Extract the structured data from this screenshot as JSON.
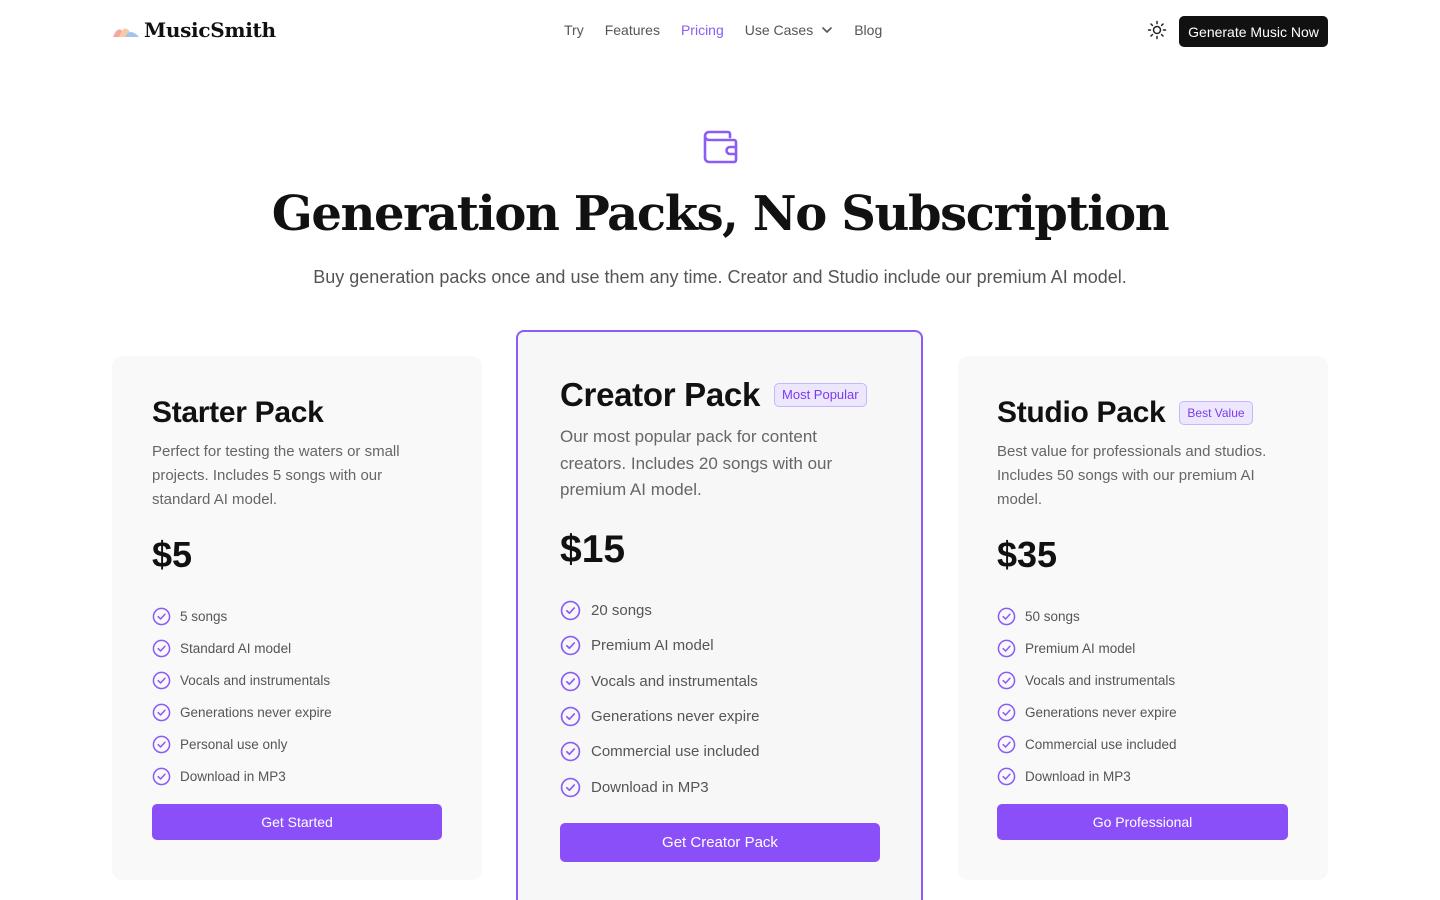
{
  "header": {
    "logo_text": "MusicSmith",
    "nav": [
      {
        "label": "Try",
        "active": false
      },
      {
        "label": "Features",
        "active": false
      },
      {
        "label": "Pricing",
        "active": true
      },
      {
        "label": "Use Cases",
        "active": false,
        "has_dropdown": true
      },
      {
        "label": "Blog",
        "active": false
      }
    ],
    "theme_icon": "sun-icon",
    "cta_label": "Generate Music Now"
  },
  "hero": {
    "icon": "wallet-icon",
    "title": "Generation Packs, No Subscription",
    "subtitle": "Buy generation packs once and use them any time. Creator and Studio include our premium AI model."
  },
  "plans": [
    {
      "name": "Starter Pack",
      "badge": "",
      "description": "Perfect for testing the waters or small projects. Includes 5 songs with our standard AI model.",
      "price": "$5",
      "features": [
        "5 songs",
        "Standard AI model",
        "Vocals and instrumentals",
        "Generations never expire",
        "Personal use only",
        "Download in MP3"
      ],
      "button_label": "Get Started"
    },
    {
      "name": "Creator Pack",
      "badge": "Most Popular",
      "description": "Our most popular pack for content creators. Includes 20 songs with our premium AI model.",
      "price": "$15",
      "features": [
        "20 songs",
        "Premium AI model",
        "Vocals and instrumentals",
        "Generations never expire",
        "Commercial use included",
        "Download in MP3"
      ],
      "button_label": "Get Creator Pack"
    },
    {
      "name": "Studio Pack",
      "badge": "Best Value",
      "description": "Best value for professionals and studios. Includes 50 songs with our premium AI model.",
      "price": "$35",
      "features": [
        "50 songs",
        "Premium AI model",
        "Vocals and instrumentals",
        "Generations never expire",
        "Commercial use included",
        "Download in MP3"
      ],
      "button_label": "Go Professional"
    }
  ],
  "colors": {
    "accent": "#8b5cf6",
    "button": "#8b4ffa",
    "text": "#111111",
    "muted": "#666666"
  }
}
